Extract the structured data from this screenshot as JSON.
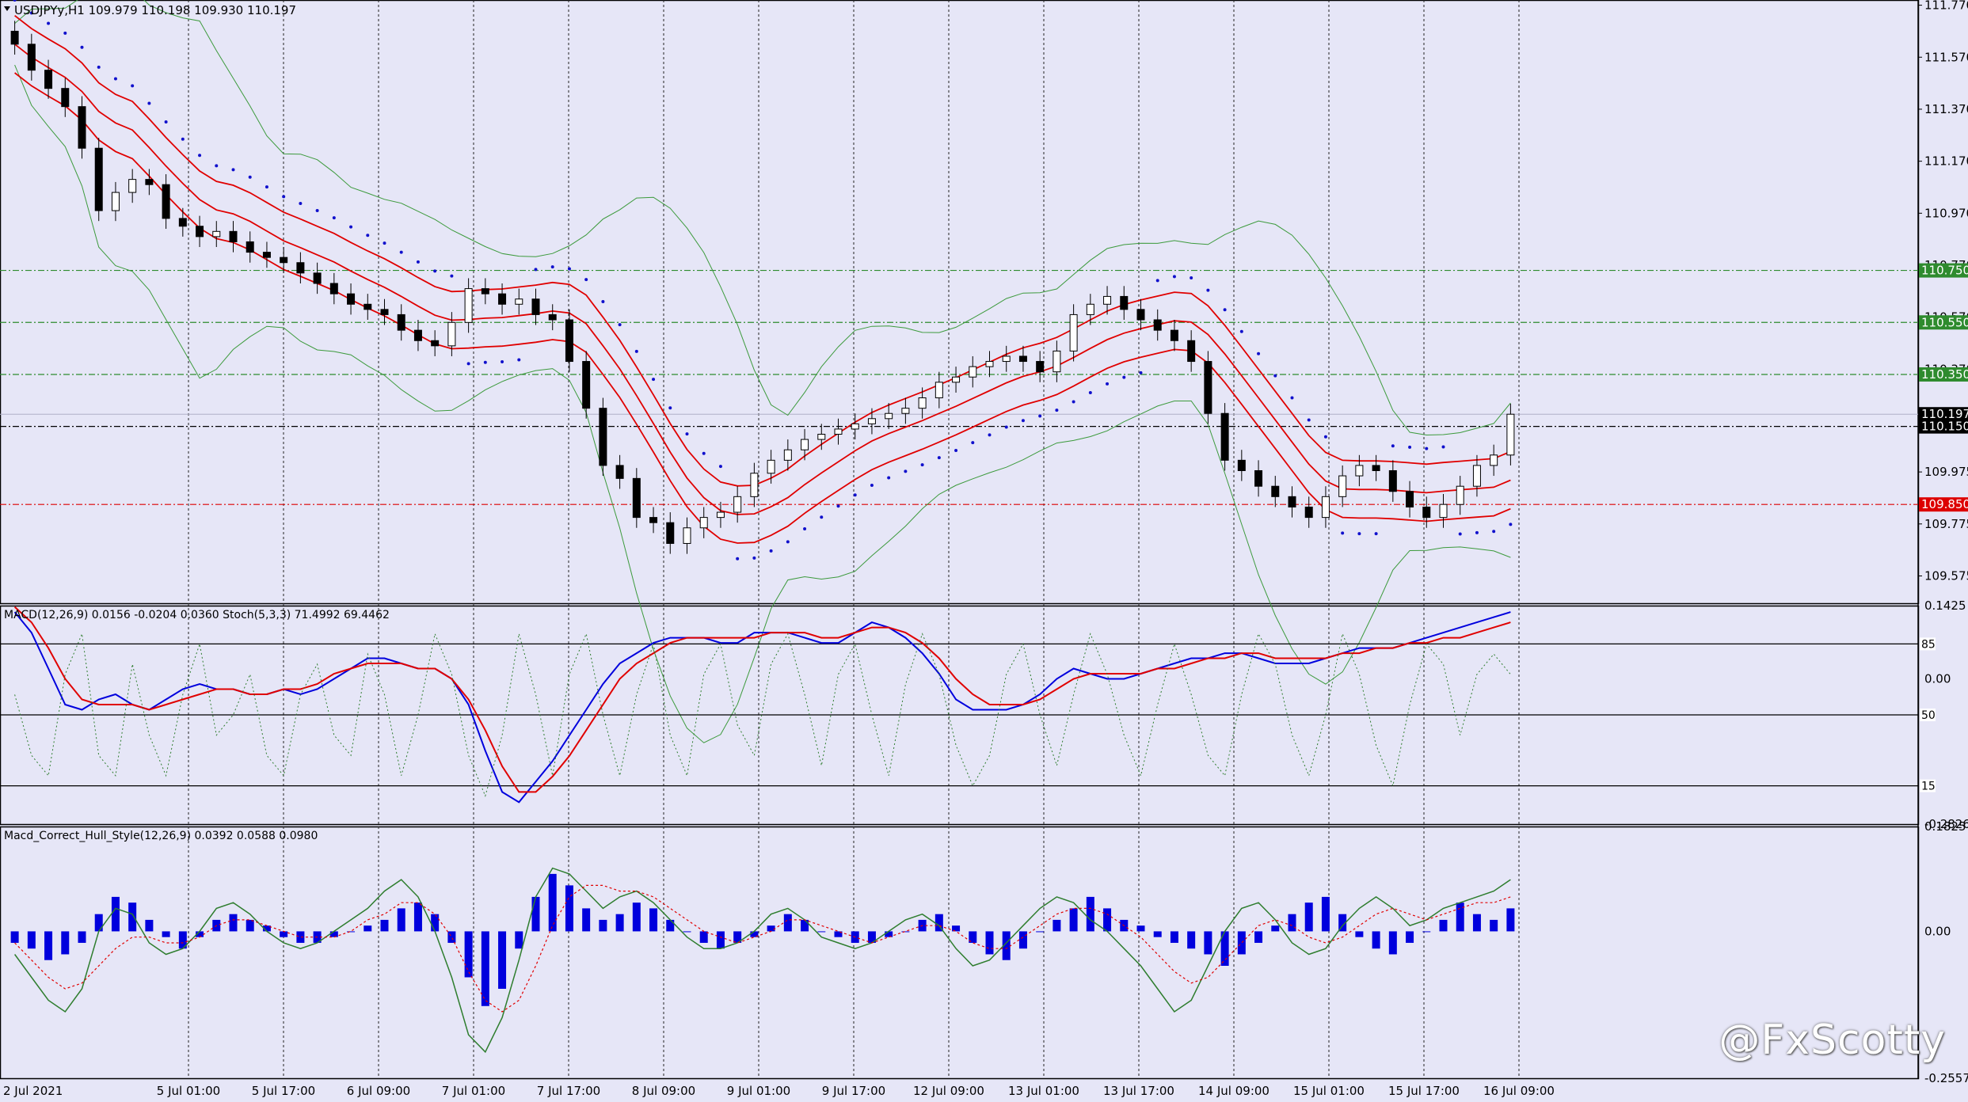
{
  "chart_data": [
    {
      "type": "candlestick",
      "symbol_header": "USDJPYy,H1  109.979 110.198 109.930 110.197",
      "ohlc_current": {
        "open": 109.979,
        "high": 110.198,
        "low": 109.93,
        "close": 110.197
      },
      "ylim": [
        109.47,
        111.79
      ],
      "y_ticks": [
        "111.770",
        "111.570",
        "111.370",
        "111.170",
        "110.970",
        "110.770",
        "110.570",
        "110.370",
        "109.975",
        "109.775",
        "109.575"
      ],
      "horizontal_levels": [
        {
          "value": 110.75,
          "label": "110.750",
          "color": "#2e8b2e",
          "style": "dash-dot"
        },
        {
          "value": 110.55,
          "label": "110.550",
          "color": "#2e8b2e",
          "style": "dash-dot"
        },
        {
          "value": 110.35,
          "label": "110.350",
          "color": "#2e8b2e",
          "style": "dash-dot"
        },
        {
          "value": 110.15,
          "label": "110.150",
          "color": "#000000",
          "style": "dash-dot"
        },
        {
          "value": 109.85,
          "label": "109.850",
          "color": "#dd0000",
          "style": "dash-dot"
        }
      ],
      "price_marker": {
        "value": 110.197,
        "label": "110.197"
      },
      "series_colors": {
        "envelope": "#e00000",
        "bollinger": "#3c9a3c",
        "sar": "#1010cc",
        "candle": "#000000"
      },
      "closes": [
        111.62,
        111.52,
        111.45,
        111.38,
        111.22,
        110.98,
        111.05,
        111.1,
        111.08,
        110.95,
        110.92,
        110.88,
        110.9,
        110.86,
        110.82,
        110.8,
        110.78,
        110.74,
        110.7,
        110.66,
        110.62,
        110.6,
        110.58,
        110.52,
        110.48,
        110.46,
        110.55,
        110.68,
        110.66,
        110.62,
        110.64,
        110.58,
        110.56,
        110.4,
        110.22,
        110.0,
        109.95,
        109.8,
        109.78,
        109.7,
        109.76,
        109.8,
        109.82,
        109.88,
        109.97,
        110.02,
        110.06,
        110.1,
        110.12,
        110.14,
        110.16,
        110.18,
        110.2,
        110.22,
        110.26,
        110.32,
        110.34,
        110.38,
        110.4,
        110.42,
        110.4,
        110.36,
        110.44,
        110.58,
        110.62,
        110.65,
        110.6,
        110.56,
        110.52,
        110.48,
        110.4,
        110.2,
        110.02,
        109.98,
        109.92,
        109.88,
        109.84,
        109.8,
        109.88,
        109.96,
        110.0,
        109.98,
        109.9,
        109.84,
        109.8,
        109.85,
        109.92,
        110.0,
        110.04,
        110.197
      ]
    },
    {
      "type": "line",
      "indicator_header": "MACD(12,26,9) 0.0156 -0.0204 0.0360  Stoch(5,3,3) 71.4992 69.4462",
      "ylim": [
        -0.2826,
        0.1425
      ],
      "y_ticks": [
        "0.1425",
        "0.00",
        "-0.2826"
      ],
      "stoch_levels": [
        {
          "value": 85,
          "label": "85"
        },
        {
          "value": 50,
          "label": "50"
        },
        {
          "value": 15,
          "label": "15"
        }
      ],
      "series": [
        {
          "role": "main",
          "color": "#0000dd",
          "values": [
            0.13,
            0.09,
            0.02,
            -0.05,
            -0.06,
            -0.04,
            -0.03,
            -0.05,
            -0.06,
            -0.04,
            -0.02,
            -0.01,
            -0.02,
            -0.02,
            -0.03,
            -0.03,
            -0.02,
            -0.03,
            -0.02,
            0.0,
            0.02,
            0.04,
            0.04,
            0.03,
            0.02,
            0.02,
            0.0,
            -0.05,
            -0.14,
            -0.22,
            -0.24,
            -0.2,
            -0.16,
            -0.11,
            -0.06,
            -0.01,
            0.03,
            0.05,
            0.07,
            0.08,
            0.08,
            0.08,
            0.07,
            0.07,
            0.09,
            0.09,
            0.09,
            0.08,
            0.07,
            0.07,
            0.09,
            0.11,
            0.1,
            0.08,
            0.05,
            0.01,
            -0.04,
            -0.06,
            -0.06,
            -0.06,
            -0.05,
            -0.03,
            0.0,
            0.02,
            0.01,
            0.0,
            0.0,
            0.01,
            0.02,
            0.03,
            0.04,
            0.04,
            0.05,
            0.05,
            0.04,
            0.03,
            0.03,
            0.03,
            0.04,
            0.05,
            0.06,
            0.06,
            0.06,
            0.07,
            0.08,
            0.09,
            0.1,
            0.11,
            0.12,
            0.13
          ]
        },
        {
          "role": "signal",
          "color": "#e00000",
          "values": [
            0.14,
            0.11,
            0.06,
            0.0,
            -0.04,
            -0.05,
            -0.05,
            -0.05,
            -0.06,
            -0.05,
            -0.04,
            -0.03,
            -0.02,
            -0.02,
            -0.03,
            -0.03,
            -0.02,
            -0.02,
            -0.01,
            0.01,
            0.02,
            0.03,
            0.03,
            0.03,
            0.02,
            0.02,
            0.0,
            -0.04,
            -0.1,
            -0.17,
            -0.22,
            -0.22,
            -0.19,
            -0.15,
            -0.1,
            -0.05,
            0.0,
            0.03,
            0.05,
            0.07,
            0.08,
            0.08,
            0.08,
            0.08,
            0.08,
            0.09,
            0.09,
            0.09,
            0.08,
            0.08,
            0.09,
            0.1,
            0.1,
            0.09,
            0.07,
            0.04,
            0.0,
            -0.03,
            -0.05,
            -0.05,
            -0.05,
            -0.04,
            -0.02,
            0.0,
            0.01,
            0.01,
            0.01,
            0.01,
            0.02,
            0.02,
            0.03,
            0.04,
            0.04,
            0.05,
            0.05,
            0.04,
            0.04,
            0.04,
            0.04,
            0.05,
            0.05,
            0.06,
            0.06,
            0.07,
            0.07,
            0.08,
            0.08,
            0.09,
            0.1,
            0.11
          ]
        },
        {
          "role": "stochastic",
          "color": "#2e7d2e",
          "style": "dotted",
          "values": [
            60,
            30,
            20,
            70,
            90,
            30,
            20,
            75,
            40,
            20,
            60,
            85,
            40,
            50,
            70,
            30,
            20,
            60,
            75,
            40,
            30,
            80,
            60,
            20,
            50,
            90,
            70,
            30,
            10,
            40,
            90,
            60,
            20,
            70,
            90,
            50,
            20,
            60,
            85,
            40,
            20,
            70,
            85,
            45,
            30,
            75,
            90,
            60,
            25,
            70,
            85,
            50,
            20,
            65,
            90,
            70,
            35,
            15,
            30,
            70,
            85,
            50,
            25,
            60,
            90,
            70,
            40,
            20,
            55,
            85,
            60,
            30,
            20,
            60,
            90,
            75,
            40,
            20,
            50,
            90,
            70,
            35,
            15,
            55,
            85,
            75,
            40,
            70,
            80,
            70
          ]
        }
      ]
    },
    {
      "type": "bar",
      "indicator_header": "Macd_Correct_Hull_Style(12,26,9) 0.0392 0.0588 0.0980",
      "ylim": [
        -0.2557,
        0.1825
      ],
      "y_ticks": [
        "0.1825",
        "0.00",
        "-0.2557"
      ],
      "series": [
        {
          "role": "histogram",
          "color": "#0000dd",
          "values": [
            -0.02,
            -0.03,
            -0.05,
            -0.04,
            -0.02,
            0.03,
            0.06,
            0.05,
            0.02,
            -0.01,
            -0.03,
            -0.01,
            0.02,
            0.03,
            0.02,
            0.01,
            -0.01,
            -0.02,
            -0.02,
            -0.01,
            0.0,
            0.01,
            0.02,
            0.04,
            0.05,
            0.03,
            -0.02,
            -0.08,
            -0.13,
            -0.1,
            -0.03,
            0.06,
            0.1,
            0.08,
            0.04,
            0.02,
            0.03,
            0.05,
            0.04,
            0.02,
            0.0,
            -0.02,
            -0.03,
            -0.02,
            -0.01,
            0.01,
            0.03,
            0.02,
            0.0,
            -0.01,
            -0.02,
            -0.02,
            -0.01,
            0.0,
            0.02,
            0.03,
            0.01,
            -0.02,
            -0.04,
            -0.05,
            -0.03,
            0.0,
            0.02,
            0.04,
            0.06,
            0.04,
            0.02,
            0.01,
            -0.01,
            -0.02,
            -0.03,
            -0.04,
            -0.06,
            -0.04,
            -0.02,
            0.01,
            0.03,
            0.05,
            0.06,
            0.03,
            -0.01,
            -0.03,
            -0.04,
            -0.02,
            0.0,
            0.02,
            0.05,
            0.03,
            0.02,
            0.04
          ]
        },
        {
          "role": "hull-line",
          "color": "#2e7d2e",
          "values": [
            -0.04,
            -0.08,
            -0.12,
            -0.14,
            -0.1,
            0.0,
            0.04,
            0.03,
            -0.02,
            -0.04,
            -0.03,
            0.0,
            0.04,
            0.05,
            0.03,
            0.0,
            -0.02,
            -0.03,
            -0.02,
            0.0,
            0.02,
            0.04,
            0.07,
            0.09,
            0.06,
            0.0,
            -0.08,
            -0.18,
            -0.21,
            -0.15,
            -0.05,
            0.06,
            0.11,
            0.1,
            0.07,
            0.04,
            0.06,
            0.07,
            0.05,
            0.02,
            -0.01,
            -0.03,
            -0.03,
            -0.02,
            0.0,
            0.03,
            0.04,
            0.02,
            -0.01,
            -0.02,
            -0.03,
            -0.02,
            0.0,
            0.02,
            0.03,
            0.01,
            -0.03,
            -0.06,
            -0.05,
            -0.02,
            0.01,
            0.04,
            0.06,
            0.05,
            0.02,
            0.0,
            -0.03,
            -0.06,
            -0.1,
            -0.14,
            -0.12,
            -0.06,
            0.0,
            0.04,
            0.05,
            0.02,
            -0.02,
            -0.04,
            -0.03,
            0.01,
            0.04,
            0.06,
            0.04,
            0.01,
            0.02,
            0.04,
            0.05,
            0.06,
            0.07,
            0.09
          ]
        },
        {
          "role": "signal",
          "color": "#e00000",
          "style": "dotted",
          "values": [
            -0.02,
            -0.05,
            -0.08,
            -0.1,
            -0.09,
            -0.06,
            -0.03,
            -0.01,
            -0.01,
            -0.02,
            -0.02,
            -0.01,
            0.01,
            0.02,
            0.02,
            0.01,
            0.0,
            -0.01,
            -0.01,
            -0.01,
            0.0,
            0.02,
            0.03,
            0.05,
            0.05,
            0.03,
            -0.01,
            -0.07,
            -0.12,
            -0.14,
            -0.12,
            -0.06,
            0.01,
            0.06,
            0.08,
            0.08,
            0.07,
            0.07,
            0.06,
            0.04,
            0.02,
            0.0,
            -0.01,
            -0.02,
            -0.01,
            0.0,
            0.02,
            0.02,
            0.01,
            0.0,
            -0.01,
            -0.02,
            -0.01,
            0.0,
            0.01,
            0.01,
            0.0,
            -0.02,
            -0.03,
            -0.03,
            -0.01,
            0.01,
            0.03,
            0.04,
            0.04,
            0.03,
            0.01,
            -0.01,
            -0.04,
            -0.07,
            -0.09,
            -0.08,
            -0.05,
            -0.02,
            0.01,
            0.02,
            0.01,
            -0.01,
            -0.02,
            -0.01,
            0.01,
            0.03,
            0.04,
            0.03,
            0.02,
            0.03,
            0.04,
            0.05,
            0.05,
            0.06
          ]
        }
      ]
    }
  ],
  "time_axis": {
    "labels": [
      "2 Jul 2021",
      "5 Jul 01:00",
      "5 Jul 17:00",
      "6 Jul 09:00",
      "7 Jul 01:00",
      "7 Jul 17:00",
      "8 Jul 09:00",
      "9 Jul 01:00",
      "9 Jul 17:00",
      "12 Jul 09:00",
      "13 Jul 01:00",
      "13 Jul 17:00",
      "14 Jul 09:00",
      "15 Jul 01:00",
      "15 Jul 17:00",
      "16 Jul 09:00"
    ]
  },
  "watermark": "@FxScotty",
  "colors": {
    "background": "#e6e6f7",
    "green_label": "#1e8c1e",
    "red_label": "#e00000",
    "black_label": "#000000",
    "label_text": "#ffffff"
  }
}
